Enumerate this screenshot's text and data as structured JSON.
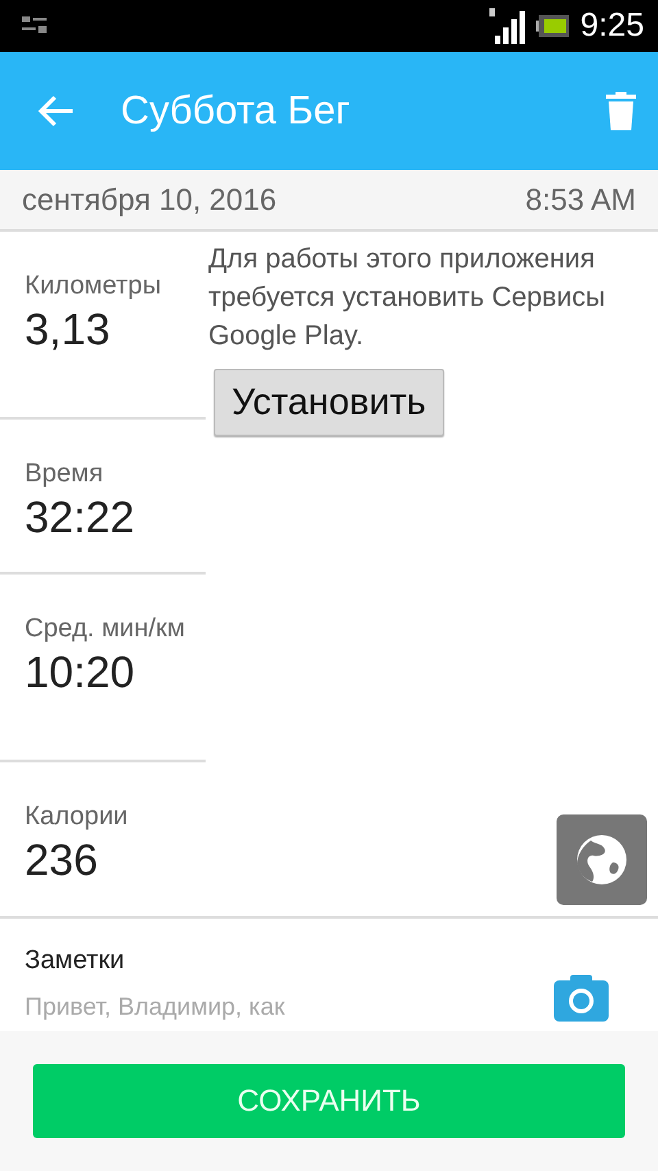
{
  "status_bar": {
    "time": "9:25"
  },
  "app_bar": {
    "title": "Суббота Бег"
  },
  "date_row": {
    "date": "сентября 10, 2016",
    "time": "8:53 AM"
  },
  "stats": [
    {
      "label": "Километры",
      "value": "3,13"
    },
    {
      "label": "Время",
      "value": "32:22"
    },
    {
      "label": "Сред. мин/км",
      "value": "10:20"
    },
    {
      "label": "Калории",
      "value": "236"
    }
  ],
  "map": {
    "message": "Для работы этого приложения требуется установить Сервисы Google Play.",
    "install_button": "Установить"
  },
  "notes": {
    "label": "Заметки",
    "value": "Привет, Владимир, как"
  },
  "save_button": "СОХРАНИТЬ"
}
